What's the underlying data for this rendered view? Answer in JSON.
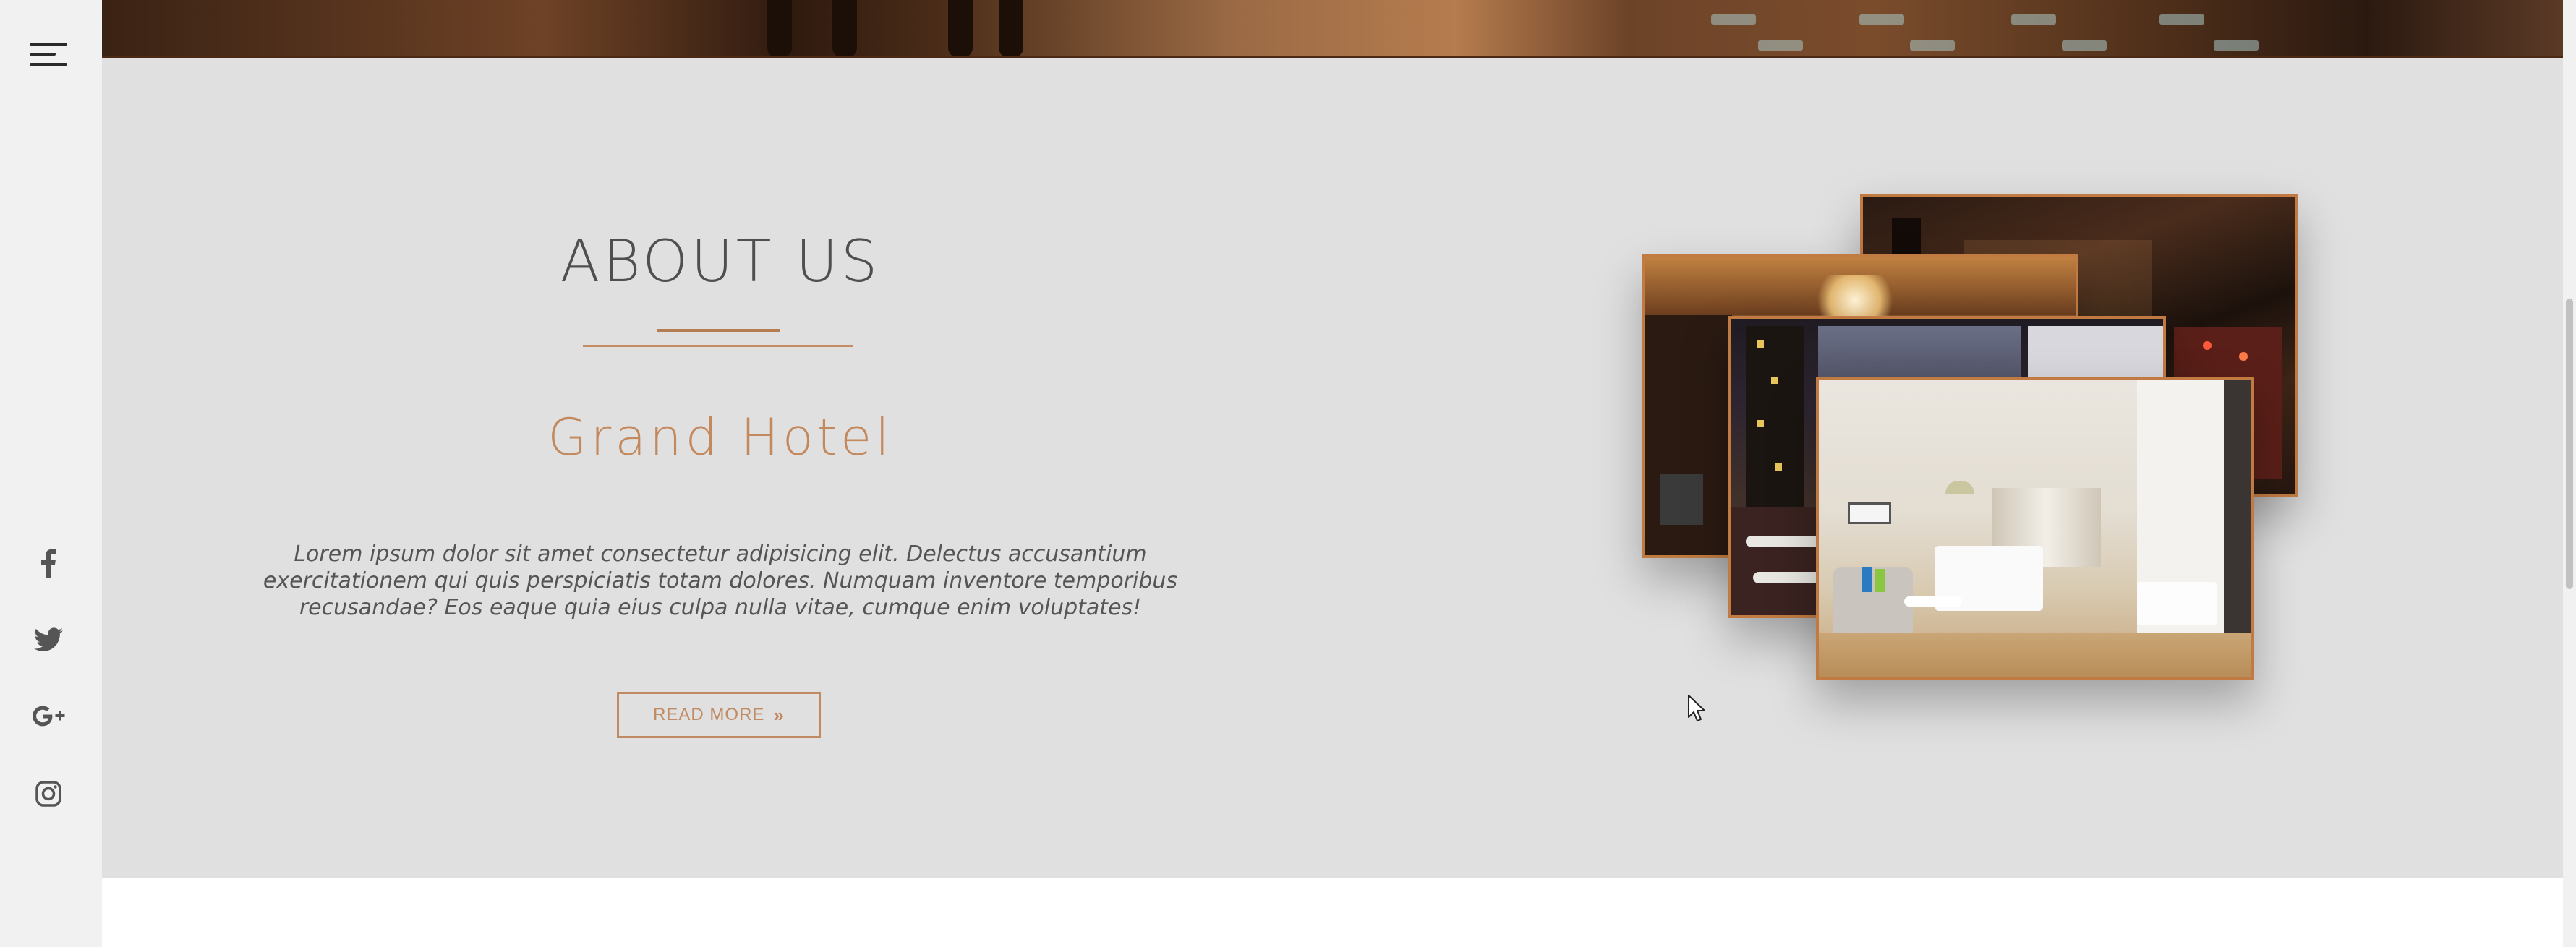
{
  "sidebar": {
    "menu_icon": "hamburger-menu-icon",
    "social": [
      {
        "name": "facebook",
        "icon": "facebook-icon"
      },
      {
        "name": "twitter",
        "icon": "twitter-icon"
      },
      {
        "name": "google-plus",
        "icon": "google-plus-icon"
      },
      {
        "name": "instagram",
        "icon": "instagram-icon"
      }
    ]
  },
  "about": {
    "title": "ABOUT US",
    "hotel_name": "Grand Hotel",
    "description": "Lorem ipsum dolor sit amet consectetur adipisicing elit. Delectus accusantium exercitationem qui quis perspiciatis totam dolores. Numquam inventore temporibus recusandae? Eos eaque quia eius culpa nulla vitae, cumque enim voluptates!",
    "read_more_label": "READ MORE",
    "read_more_icon": "double-chevron-right-icon"
  },
  "colors": {
    "accent": "#c4885d",
    "section_bg": "#e0e0e0",
    "sidebar_bg": "#f1f1f1",
    "text_dark": "#4f4f4f",
    "text_body": "#555555"
  }
}
